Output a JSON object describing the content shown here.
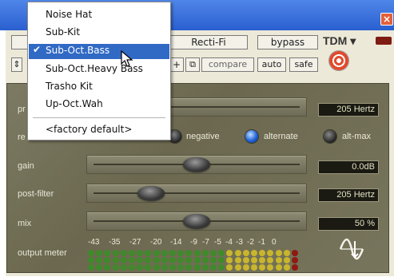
{
  "window": {
    "close_label": "×"
  },
  "toolbar": {
    "plugin_name": "Recti-Fi",
    "bypass_label": "bypass",
    "compare_label": "compare",
    "auto_label": "auto",
    "safe_label": "safe",
    "plus_label": "+",
    "copy_label": "⧉",
    "tdm_label": "TDM ▾",
    "arrow_label": "⇕"
  },
  "menu": {
    "items": [
      "Noise Hat",
      "Sub-Kit",
      "Sub-Oct.Bass",
      "Sub-Oct.Heavy Bass",
      "Trasho Kit",
      "Up-Oct.Wah"
    ],
    "selected_index": 2,
    "checkmark": "✔",
    "factory_default": "<factory default>"
  },
  "controls": {
    "prefilter": {
      "label_partial": "pr",
      "value": "205 Hertz",
      "position": 0.85
    },
    "rectification": {
      "label_partial": "re",
      "options": [
        "negative",
        "alternate",
        "alt-max"
      ],
      "selected": "alternate"
    },
    "gain": {
      "label": "gain",
      "value": "0.0dB",
      "position": 0.5
    },
    "post_filter": {
      "label": "post-filter",
      "value": "205 Hertz",
      "position": 0.27
    },
    "mix": {
      "label": "mix",
      "value": "50 %",
      "position": 0.5
    }
  },
  "meter": {
    "label": "output meter",
    "scale": [
      "-43",
      "-35",
      "-27",
      "-20",
      "-14",
      "-9",
      "-7",
      "-5",
      "-4",
      "-3",
      "-2",
      "-1",
      "0"
    ],
    "colors": {
      "green": "#3f8a2a",
      "yellow": "#c8b62c",
      "red": "#8e1a12"
    }
  },
  "colors": {
    "panel": "#77745c",
    "menu_highlight": "#316ac5",
    "titlebar": "#3b6fd8"
  }
}
